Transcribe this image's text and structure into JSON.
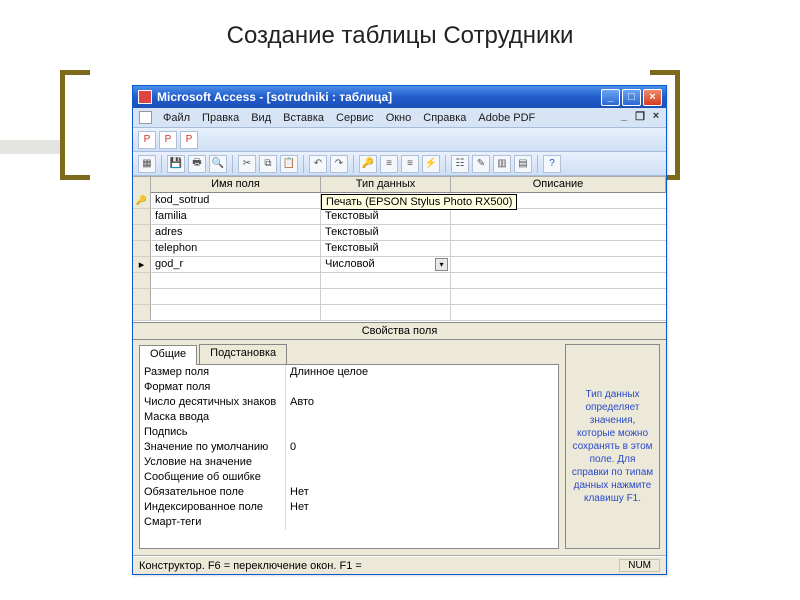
{
  "slide_title": "Создание таблицы Сотрудники",
  "window": {
    "title": "Microsoft Access - [sotrudniki : таблица]",
    "min_icon": "_",
    "max_icon": "□",
    "close_icon": "×"
  },
  "menu": {
    "items": [
      "Файл",
      "Правка",
      "Вид",
      "Вставка",
      "Сервис",
      "Окно",
      "Справка",
      "Adobe PDF"
    ]
  },
  "grid": {
    "headers": {
      "name": "Имя поля",
      "type": "Тип данных",
      "desc": "Описание"
    },
    "rows": [
      {
        "key": true,
        "name": "kod_sotrud",
        "type": "",
        "current": false
      },
      {
        "key": false,
        "name": "familia",
        "type": "Текстовый",
        "current": false
      },
      {
        "key": false,
        "name": "adres",
        "type": "Текстовый",
        "current": false
      },
      {
        "key": false,
        "name": "telephon",
        "type": "Текстовый",
        "current": false
      },
      {
        "key": false,
        "name": "god_r",
        "type": "Числовой",
        "current": true
      }
    ],
    "tooltip": "Печать (EPSON Stylus Photo RX500)"
  },
  "props": {
    "title": "Свойства поля",
    "tabs": {
      "general": "Общие",
      "lookup": "Подстановка"
    },
    "items": [
      {
        "label": "Размер поля",
        "value": "Длинное целое"
      },
      {
        "label": "Формат поля",
        "value": ""
      },
      {
        "label": "Число десятичных знаков",
        "value": "Авто"
      },
      {
        "label": "Маска ввода",
        "value": ""
      },
      {
        "label": "Подпись",
        "value": ""
      },
      {
        "label": "Значение по умолчанию",
        "value": "0"
      },
      {
        "label": "Условие на значение",
        "value": ""
      },
      {
        "label": "Сообщение об ошибке",
        "value": ""
      },
      {
        "label": "Обязательное поле",
        "value": "Нет"
      },
      {
        "label": "Индексированное поле",
        "value": "Нет"
      },
      {
        "label": "Смарт-теги",
        "value": ""
      }
    ],
    "hint": "Тип данных определяет значения, которые можно сохранять в этом поле.  Для справки по типам данных нажмите клавишу F1."
  },
  "status": {
    "left": "Конструктор.  F6 = переключение окон.  F1 =",
    "num": "NUM"
  }
}
